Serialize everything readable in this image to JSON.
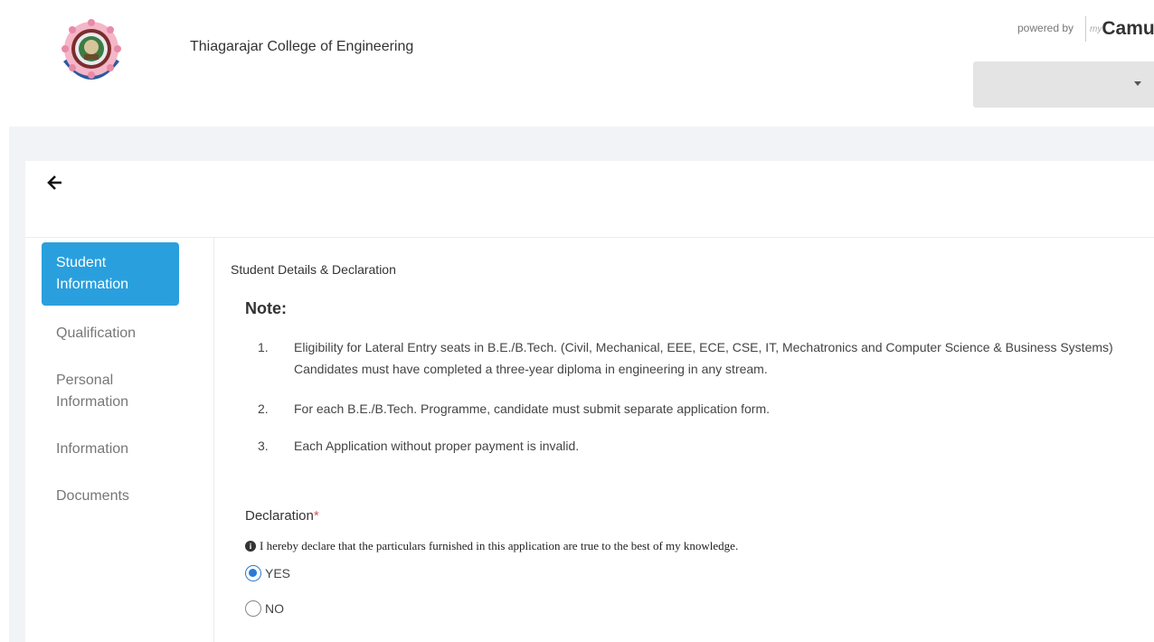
{
  "header": {
    "college_name": "Thiagarajar College of Engineering",
    "powered_by": "powered by",
    "brand_my": "my",
    "brand_name": "Camu"
  },
  "sidebar": {
    "items": [
      {
        "label": "Student Information",
        "active": true
      },
      {
        "label": "Qualification",
        "active": false
      },
      {
        "label": "Personal Information",
        "active": false
      },
      {
        "label": "Information",
        "active": false
      },
      {
        "label": "Documents",
        "active": false
      }
    ]
  },
  "main": {
    "section_title": "Student Details & Declaration",
    "note_title": "Note:",
    "notes": [
      {
        "num": "1.",
        "text": "Eligibility for Lateral Entry seats in B.E./B.Tech. (Civil, Mechanical, EEE, ECE, CSE, IT, Mechatronics and Computer Science & Business Systems) Candidates must have completed a three-year diploma in engineering in any stream."
      },
      {
        "num": "2.",
        "text": "For each B.E./B.Tech. Programme, candidate must submit separate application form."
      },
      {
        "num": "3.",
        "text": "Each Application without proper payment is invalid."
      }
    ],
    "declaration": {
      "label": "Declaration",
      "required_mark": "*",
      "info_text": "I hereby declare that the particulars furnished in this application are true to the best of my knowledge.",
      "options": [
        {
          "label": "YES",
          "selected": true
        },
        {
          "label": "NO",
          "selected": false
        }
      ]
    }
  },
  "colors": {
    "accent": "#2a9fdd",
    "radio_selected": "#2a7bd6",
    "required": "#d9534f"
  }
}
